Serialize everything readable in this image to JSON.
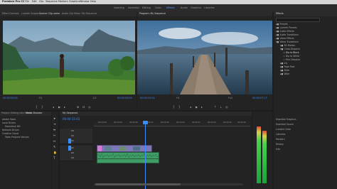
{
  "menubar": {
    "app_name": "Premiere Pro CC",
    "menus": [
      "File",
      "Edit",
      "Clip",
      "Sequence",
      "Markers",
      "Graphics",
      "Window",
      "Help"
    ]
  },
  "workspaces": [
    "Learning",
    "Assembly",
    "Editing",
    "Color",
    "Effects",
    "Audio",
    "Graphics",
    "Libraries"
  ],
  "active_workspace": "Effects",
  "source_monitor": {
    "tabs": [
      "Effect Controls",
      "Lumetri Scopes",
      "Source: Clip name",
      "Audio Clip Mixer: My Sequence"
    ],
    "active_tab": "Source: Clip name",
    "timecode_in": "00:00:00:00",
    "timecode_out": "00:00:03:05",
    "fit": "Fit",
    "fraction": "1/2"
  },
  "program_monitor": {
    "tabs": [
      "Program: My Sequence"
    ],
    "timecode_in": "00:00:15:01",
    "timecode_out": "00:00:07:17",
    "fit": "Fit",
    "fraction": "Full"
  },
  "effects_panel": {
    "title": "Effects",
    "search_placeholder": "",
    "items": [
      "Presets",
      "Lumetri Presets",
      "Audio Effects",
      "Audio Transitions",
      "Video Effects",
      "Video Transitions",
      "3D Motion",
      "Cross Dissolve",
      "Dip to Black",
      "Dip to White",
      "Film Dissolve",
      "Iris",
      "Page Peel",
      "Slide",
      "Wipe"
    ],
    "lower_items": [
      "Essential Graphics",
      "Essential Sound",
      "Lumetri Color",
      "Libraries",
      "Markers",
      "History",
      "Info"
    ]
  },
  "project_panel": {
    "tabs": [
      "Project: Editing intro video",
      "Media Browser"
    ],
    "items": [
      "Adobe Stock",
      "Local Drives",
      "Macintosh HD",
      "Network Drives",
      "Creative Cloud",
      "Team Projects Version"
    ]
  },
  "timeline": {
    "tab": "My Sequence",
    "timecode": "00:00:15:01",
    "tracks_video": [
      "V3",
      "V2",
      "V1"
    ],
    "tracks_audio": [
      "A1",
      "A2",
      "A3"
    ],
    "ruler_labels": [
      "00:00:00",
      "00:00:04",
      "00:00:08",
      "00:00:12",
      "00:00:16",
      "00:00:20",
      "00:00:24",
      "00:00:28",
      "00:00:32",
      "00:00:36"
    ]
  },
  "colors": {
    "accent_blue": "#3a8dff",
    "clip_video": "#8a79c2",
    "clip_audio": "#43a56b",
    "clip_pink": "#d67bd6"
  }
}
